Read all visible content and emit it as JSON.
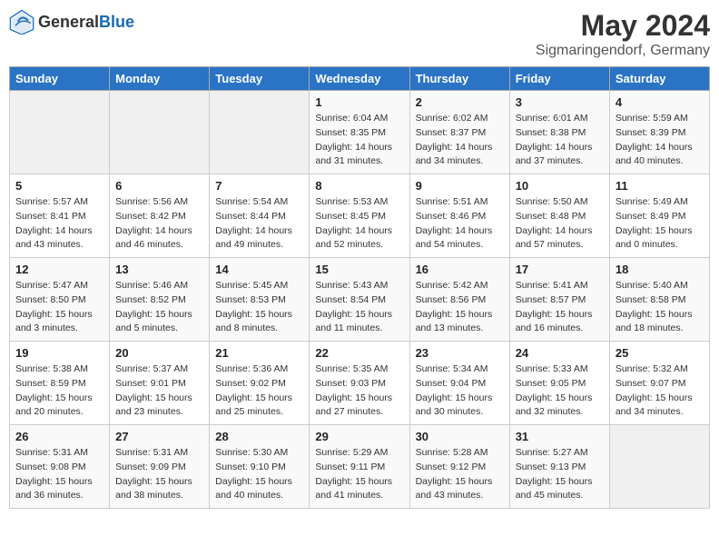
{
  "header": {
    "logo_general": "General",
    "logo_blue": "Blue",
    "month": "May 2024",
    "location": "Sigmaringendorf, Germany"
  },
  "weekdays": [
    "Sunday",
    "Monday",
    "Tuesday",
    "Wednesday",
    "Thursday",
    "Friday",
    "Saturday"
  ],
  "weeks": [
    [
      {
        "day": "",
        "info": ""
      },
      {
        "day": "",
        "info": ""
      },
      {
        "day": "",
        "info": ""
      },
      {
        "day": "1",
        "info": "Sunrise: 6:04 AM\nSunset: 8:35 PM\nDaylight: 14 hours\nand 31 minutes."
      },
      {
        "day": "2",
        "info": "Sunrise: 6:02 AM\nSunset: 8:37 PM\nDaylight: 14 hours\nand 34 minutes."
      },
      {
        "day": "3",
        "info": "Sunrise: 6:01 AM\nSunset: 8:38 PM\nDaylight: 14 hours\nand 37 minutes."
      },
      {
        "day": "4",
        "info": "Sunrise: 5:59 AM\nSunset: 8:39 PM\nDaylight: 14 hours\nand 40 minutes."
      }
    ],
    [
      {
        "day": "5",
        "info": "Sunrise: 5:57 AM\nSunset: 8:41 PM\nDaylight: 14 hours\nand 43 minutes."
      },
      {
        "day": "6",
        "info": "Sunrise: 5:56 AM\nSunset: 8:42 PM\nDaylight: 14 hours\nand 46 minutes."
      },
      {
        "day": "7",
        "info": "Sunrise: 5:54 AM\nSunset: 8:44 PM\nDaylight: 14 hours\nand 49 minutes."
      },
      {
        "day": "8",
        "info": "Sunrise: 5:53 AM\nSunset: 8:45 PM\nDaylight: 14 hours\nand 52 minutes."
      },
      {
        "day": "9",
        "info": "Sunrise: 5:51 AM\nSunset: 8:46 PM\nDaylight: 14 hours\nand 54 minutes."
      },
      {
        "day": "10",
        "info": "Sunrise: 5:50 AM\nSunset: 8:48 PM\nDaylight: 14 hours\nand 57 minutes."
      },
      {
        "day": "11",
        "info": "Sunrise: 5:49 AM\nSunset: 8:49 PM\nDaylight: 15 hours\nand 0 minutes."
      }
    ],
    [
      {
        "day": "12",
        "info": "Sunrise: 5:47 AM\nSunset: 8:50 PM\nDaylight: 15 hours\nand 3 minutes."
      },
      {
        "day": "13",
        "info": "Sunrise: 5:46 AM\nSunset: 8:52 PM\nDaylight: 15 hours\nand 5 minutes."
      },
      {
        "day": "14",
        "info": "Sunrise: 5:45 AM\nSunset: 8:53 PM\nDaylight: 15 hours\nand 8 minutes."
      },
      {
        "day": "15",
        "info": "Sunrise: 5:43 AM\nSunset: 8:54 PM\nDaylight: 15 hours\nand 11 minutes."
      },
      {
        "day": "16",
        "info": "Sunrise: 5:42 AM\nSunset: 8:56 PM\nDaylight: 15 hours\nand 13 minutes."
      },
      {
        "day": "17",
        "info": "Sunrise: 5:41 AM\nSunset: 8:57 PM\nDaylight: 15 hours\nand 16 minutes."
      },
      {
        "day": "18",
        "info": "Sunrise: 5:40 AM\nSunset: 8:58 PM\nDaylight: 15 hours\nand 18 minutes."
      }
    ],
    [
      {
        "day": "19",
        "info": "Sunrise: 5:38 AM\nSunset: 8:59 PM\nDaylight: 15 hours\nand 20 minutes."
      },
      {
        "day": "20",
        "info": "Sunrise: 5:37 AM\nSunset: 9:01 PM\nDaylight: 15 hours\nand 23 minutes."
      },
      {
        "day": "21",
        "info": "Sunrise: 5:36 AM\nSunset: 9:02 PM\nDaylight: 15 hours\nand 25 minutes."
      },
      {
        "day": "22",
        "info": "Sunrise: 5:35 AM\nSunset: 9:03 PM\nDaylight: 15 hours\nand 27 minutes."
      },
      {
        "day": "23",
        "info": "Sunrise: 5:34 AM\nSunset: 9:04 PM\nDaylight: 15 hours\nand 30 minutes."
      },
      {
        "day": "24",
        "info": "Sunrise: 5:33 AM\nSunset: 9:05 PM\nDaylight: 15 hours\nand 32 minutes."
      },
      {
        "day": "25",
        "info": "Sunrise: 5:32 AM\nSunset: 9:07 PM\nDaylight: 15 hours\nand 34 minutes."
      }
    ],
    [
      {
        "day": "26",
        "info": "Sunrise: 5:31 AM\nSunset: 9:08 PM\nDaylight: 15 hours\nand 36 minutes."
      },
      {
        "day": "27",
        "info": "Sunrise: 5:31 AM\nSunset: 9:09 PM\nDaylight: 15 hours\nand 38 minutes."
      },
      {
        "day": "28",
        "info": "Sunrise: 5:30 AM\nSunset: 9:10 PM\nDaylight: 15 hours\nand 40 minutes."
      },
      {
        "day": "29",
        "info": "Sunrise: 5:29 AM\nSunset: 9:11 PM\nDaylight: 15 hours\nand 41 minutes."
      },
      {
        "day": "30",
        "info": "Sunrise: 5:28 AM\nSunset: 9:12 PM\nDaylight: 15 hours\nand 43 minutes."
      },
      {
        "day": "31",
        "info": "Sunrise: 5:27 AM\nSunset: 9:13 PM\nDaylight: 15 hours\nand 45 minutes."
      },
      {
        "day": "",
        "info": ""
      }
    ]
  ]
}
